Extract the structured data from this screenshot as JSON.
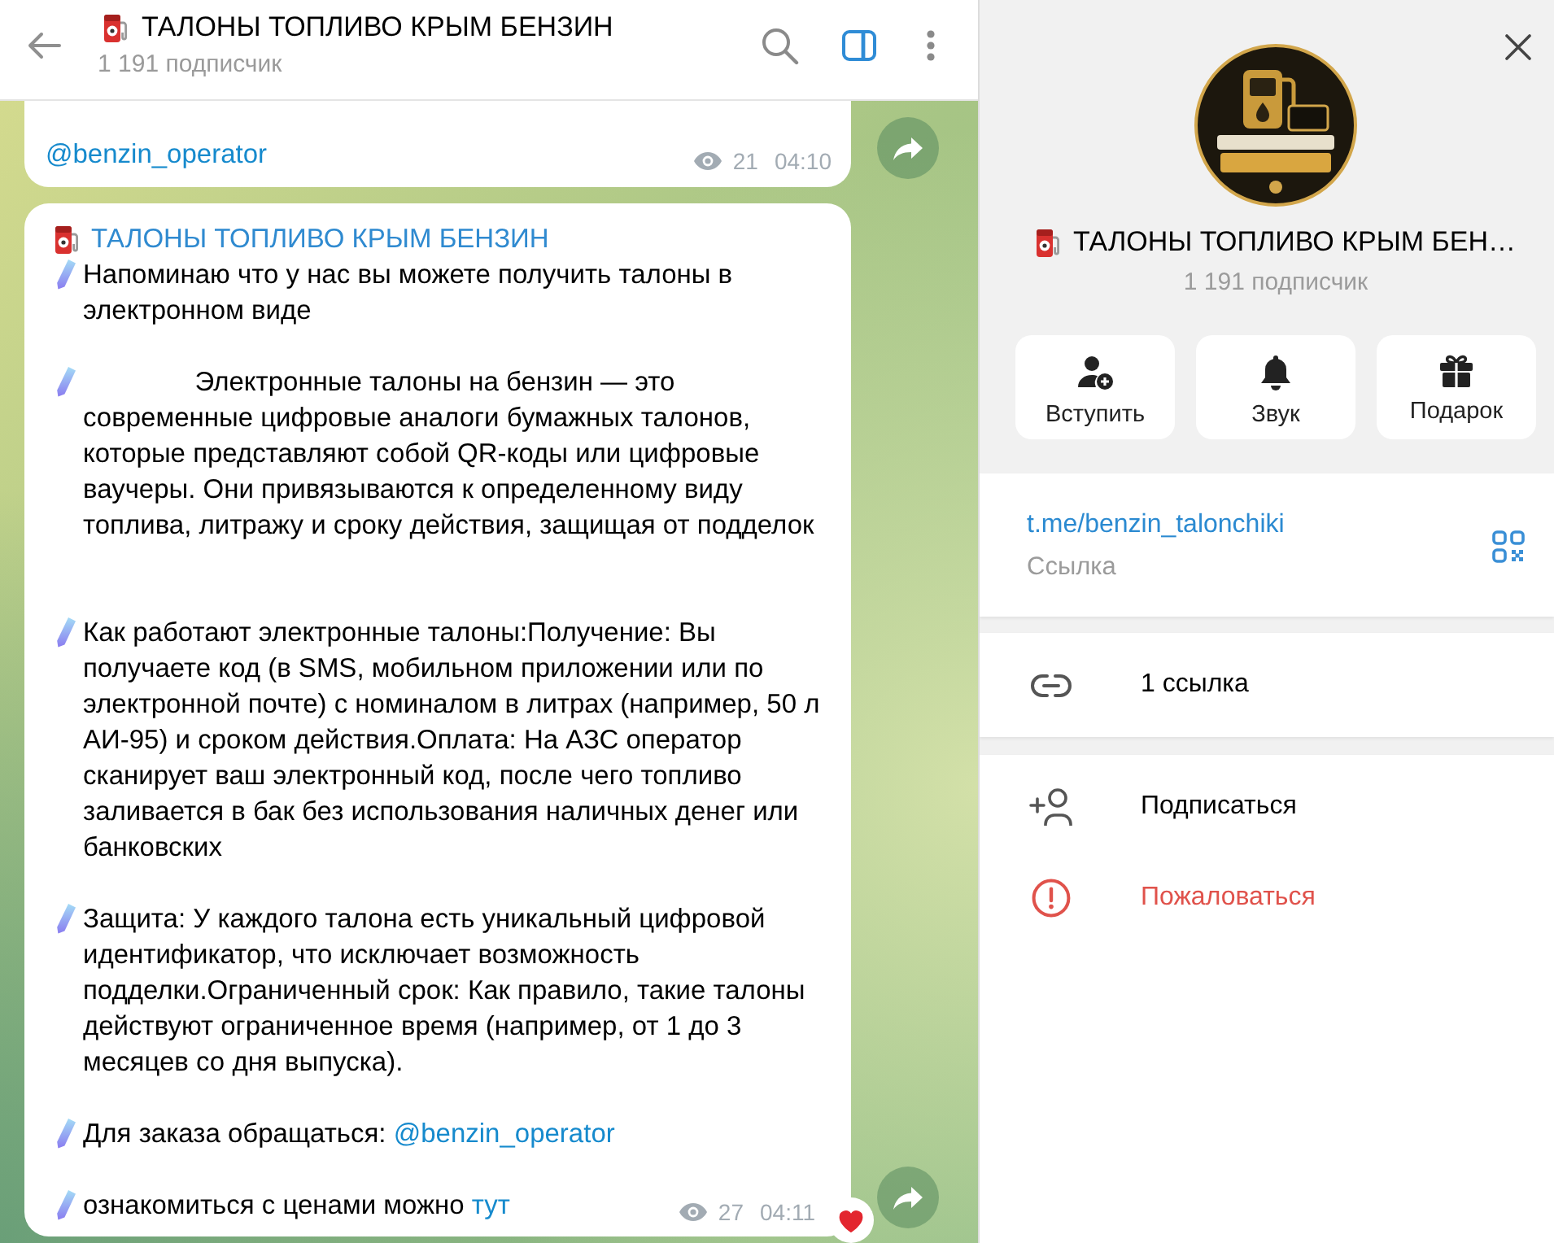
{
  "header": {
    "title": "ТАЛОНЫ ТОПЛИВО КРЫМ БЕНЗИН",
    "subscribers": "1 191 подписчик",
    "panel_toggle": {
      "on": true
    }
  },
  "messages": [
    {
      "paragraphs": [
        {
          "kind": "plain",
          "link": "@benzin_operator"
        }
      ],
      "views": "21",
      "time": "04:10"
    },
    {
      "author": "ТАЛОНЫ ТОПЛИВО КРЫМ БЕНЗИН",
      "paragraphs": [
        {
          "kind": "emoji",
          "text": "Напоминаю что у нас вы можете получить талоны в электронном виде"
        },
        {
          "kind": "emoji",
          "text": "               Электронные талоны на бензин — это современные цифровые аналоги бумажных талонов, которые представляют собой QR-коды или цифровые ваучеры. Они привязываются к определенному виду топлива, литражу и сроку действия, защищая от подделок\n\n"
        },
        {
          "kind": "emoji",
          "text": "Как работают электронные талоны:Получение: Вы получаете код (в SMS, мобильном приложении или по электронной почте) с номиналом в литрах (например, 50 л АИ-95) и сроком действия.Оплата: На АЗС оператор сканирует ваш электронный код, после чего топливо заливается в бак без использования наличных денег или банковских"
        },
        {
          "kind": "emoji",
          "text": "Защита: У каждого талона есть уникальный цифровой идентификатор, что исключает возможность подделки.Ограниченный срок: Как правило, такие талоны действуют ограниченное время (например, от 1 до 3 месяцев со дня выпуска)."
        },
        {
          "kind": "emoji",
          "text": "Для заказа обращаться:",
          "link": "@benzin_operator"
        },
        {
          "kind": "emoji",
          "text": "ознакомиться с ценами можно",
          "link": "тут"
        }
      ],
      "views": "27",
      "time": "04:11",
      "reactions": [
        {
          "kind": "heart"
        }
      ]
    }
  ],
  "profile": {
    "title": "ТАЛОНЫ ТОПЛИВО КРЫМ БЕН…",
    "subscribers": "1 191 подписчик",
    "actions": [
      {
        "kind": "join",
        "label": "Вступить"
      },
      {
        "kind": "sound",
        "label": "Звук"
      },
      {
        "kind": "gift",
        "label": "Подарок"
      }
    ],
    "link": {
      "url": "t.me/benzin_talonchiki",
      "caption": "Ссылка"
    },
    "links": {
      "label": "1 ссылка"
    },
    "menu": [
      {
        "kind": "subscribe",
        "label": "Подписаться"
      },
      {
        "kind": "report",
        "label": "Пожаловаться"
      }
    ]
  }
}
